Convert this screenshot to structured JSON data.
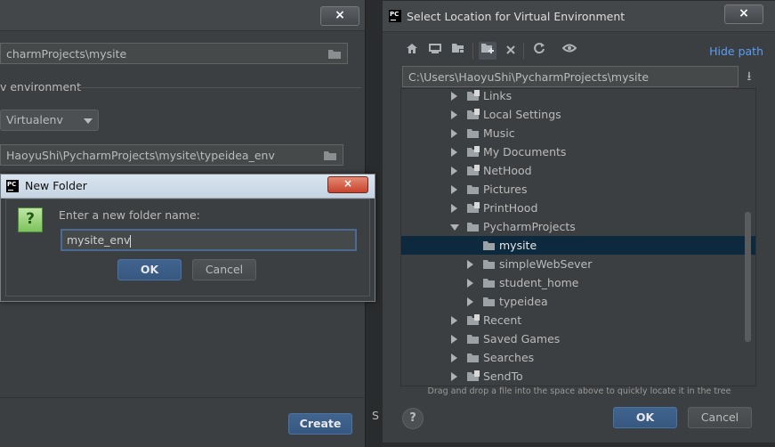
{
  "left_dialog": {
    "project_path": "charmProjects\\mysite",
    "section_label": "v environment",
    "env_type": "Virtualenv",
    "env_location": "HaoyuShi\\PycharmProjects\\mysite\\typeidea_env",
    "create_button": "Create",
    "close_label": "×",
    "partial_text": "S"
  },
  "new_folder_dialog": {
    "title": "New Folder",
    "logo_text": "PC",
    "prompt": "Enter a new folder name:",
    "input_value": "mysite_env",
    "question_mark": "?",
    "ok_label": "OK",
    "cancel_label": "Cancel",
    "close_label": "×"
  },
  "select_dialog": {
    "title": "Select Location for Virtual Environment",
    "logo_text": "PC",
    "close_label": "×",
    "hide_path": "Hide path",
    "path": "C:\\Users\\HaoyuShi\\PycharmProjects\\mysite",
    "download_icon": "⭳",
    "tree": [
      {
        "label": "Links",
        "level": 0,
        "expander": "right",
        "icon": "special-folder-icon"
      },
      {
        "label": "Local Settings",
        "level": 0,
        "expander": "right",
        "icon": "special-folder-icon"
      },
      {
        "label": "Music",
        "level": 0,
        "expander": "right",
        "icon": "folder-icon"
      },
      {
        "label": "My Documents",
        "level": 0,
        "expander": "right",
        "icon": "special-folder-icon"
      },
      {
        "label": "NetHood",
        "level": 0,
        "expander": "right",
        "icon": "special-folder-icon"
      },
      {
        "label": "Pictures",
        "level": 0,
        "expander": "right",
        "icon": "folder-icon"
      },
      {
        "label": "PrintHood",
        "level": 0,
        "expander": "right",
        "icon": "special-folder-icon"
      },
      {
        "label": "PycharmProjects",
        "level": 0,
        "expander": "down",
        "icon": "folder-icon"
      },
      {
        "label": "mysite",
        "level": 1,
        "expander": "none",
        "icon": "folder-icon",
        "selected": true
      },
      {
        "label": "simpleWebSever",
        "level": 1,
        "expander": "right",
        "icon": "folder-icon"
      },
      {
        "label": "student_home",
        "level": 1,
        "expander": "right",
        "icon": "folder-icon"
      },
      {
        "label": "typeidea",
        "level": 1,
        "expander": "right",
        "icon": "folder-icon"
      },
      {
        "label": "Recent",
        "level": 0,
        "expander": "right",
        "icon": "special-folder-icon"
      },
      {
        "label": "Saved Games",
        "level": 0,
        "expander": "right",
        "icon": "folder-icon"
      },
      {
        "label": "Searches",
        "level": 0,
        "expander": "right",
        "icon": "folder-icon"
      },
      {
        "label": "SendTo",
        "level": 0,
        "expander": "right",
        "icon": "special-folder-icon"
      }
    ],
    "hint": "Drag and drop a file into the space above to quickly locate it in the tree",
    "help_label": "?",
    "ok_label": "OK",
    "cancel_label": "Cancel"
  },
  "colors": {
    "panel": "#3c3f41",
    "selection": "#0d293e",
    "link": "#589df6",
    "primary_button": "#365880"
  }
}
